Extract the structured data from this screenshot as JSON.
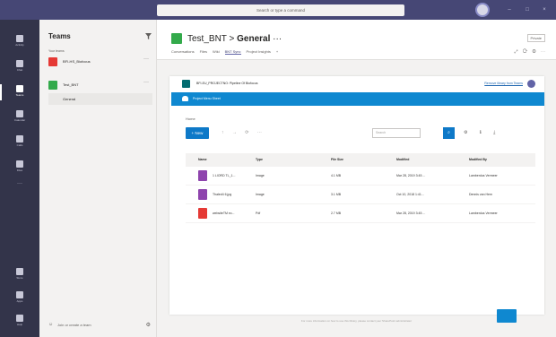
{
  "window": {
    "search_placeholder": "Search or type a command",
    "controls": [
      "–",
      "□",
      "×"
    ],
    "accent": "#464775"
  },
  "rail": {
    "items": [
      {
        "label": "Activity",
        "icon": "bell-icon"
      },
      {
        "label": "Chat",
        "icon": "chat-icon"
      },
      {
        "label": "Teams",
        "icon": "teams-icon"
      },
      {
        "label": "Calendar",
        "icon": "calendar-icon"
      },
      {
        "label": "Calls",
        "icon": "phone-icon"
      },
      {
        "label": "Files",
        "icon": "file-icon"
      }
    ],
    "bottom_items": [
      {
        "label": "Store",
        "icon": "store-icon"
      },
      {
        "label": "Apps",
        "icon": "apps-icon"
      },
      {
        "label": "Help",
        "icon": "help-icon"
      }
    ],
    "more": "···"
  },
  "teams_panel": {
    "title": "Teams",
    "section_label": "Your teams",
    "teams": [
      {
        "name": "BFI-HS_Biofocus",
        "color": "#e53935",
        "more": "···"
      },
      {
        "name": "Test_BNT",
        "color": "#33aa4b",
        "more": "···"
      }
    ],
    "channel": "General",
    "join_label": "Join or create a team"
  },
  "header": {
    "team": "Test_BNT",
    "separator": ">",
    "channel": "General",
    "channel_more": "···",
    "org_button": "Private",
    "tabs": [
      "Conversations",
      "Files",
      "Wiki",
      "BNT Sync",
      "Project Insights",
      "+"
    ],
    "active_tab": 3,
    "icons": [
      "expand-icon",
      "refresh-icon",
      "globe-icon",
      "more-icon"
    ]
  },
  "sp": {
    "path": "BFI-EU_PROJECTNO: Pipeline Of Biofocus",
    "link": "Remove library from Teams",
    "banner": "Project Menu Sheet",
    "home": "Home",
    "new_label": "+ New",
    "tb_icons": [
      "↑",
      "→",
      "⟳",
      "⋯"
    ],
    "search_placeholder": "Search",
    "right_icons": [
      "⚙",
      "ℹ",
      "⤓"
    ],
    "columns": [
      "Name",
      "Type",
      "File Size",
      "Modified",
      "Modified By"
    ],
    "rows": [
      {
        "name": "1 LIORD TL_1...",
        "type": "Image",
        "size": "4.1 MB",
        "modified": "Mar 28, 2019 3:45 ...",
        "by": "Lamberdus Vermeer",
        "icon_color": "#8e44ad"
      },
      {
        "name": "Thaled4 6.jpg",
        "type": "Image",
        "size": "3.1 MB",
        "modified": "Oct 10, 2018 1:41...",
        "by": "Dennis van Hem",
        "icon_color": "#8e44ad"
      },
      {
        "name": "websiteTM ec...",
        "type": "Pdf",
        "size": "2.7 MB",
        "modified": "Mar 28, 2019 3:45 ...",
        "by": "Lamberdus Vermeer",
        "icon_color": "#e53935"
      }
    ],
    "footer": "For more information on how to use this library, please contact your SharePoint administrator"
  }
}
